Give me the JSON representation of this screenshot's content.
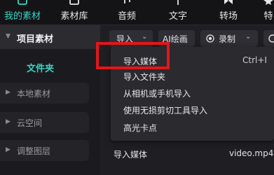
{
  "top_tabs": [
    {
      "label": "我的素材",
      "icon": "my-assets-icon"
    },
    {
      "label": "素材库",
      "icon": "library-icon"
    },
    {
      "label": "音频",
      "icon": "audio-icon"
    },
    {
      "label": "文字",
      "icon": "text-icon"
    },
    {
      "label": "转场",
      "icon": "transition-icon"
    },
    {
      "label": "特",
      "icon": "effects-icon"
    }
  ],
  "sidebar": {
    "header": "项目素材",
    "folder": "文件夹",
    "items": [
      {
        "label": "本地素材"
      },
      {
        "label": "云空间"
      },
      {
        "label": "调整图层"
      }
    ]
  },
  "toolbar": {
    "import_label": "导入",
    "ai_label": "AI绘画",
    "record_label": "录制"
  },
  "import_menu": {
    "items": [
      {
        "label": "导入媒体",
        "shortcut": "Ctrl+I"
      },
      {
        "label": "导入文件夹",
        "shortcut": ""
      },
      {
        "label": "从相机或手机导入",
        "shortcut": ""
      },
      {
        "label": "使用无损剪切工具导入",
        "shortcut": ""
      },
      {
        "label": "高光卡点",
        "shortcut": ""
      }
    ]
  },
  "content": {
    "import_media_label": "导入媒体",
    "file_name": "video.mp4"
  },
  "colors": {
    "accent": "#37d6c6",
    "highlight": "#e3161a"
  }
}
